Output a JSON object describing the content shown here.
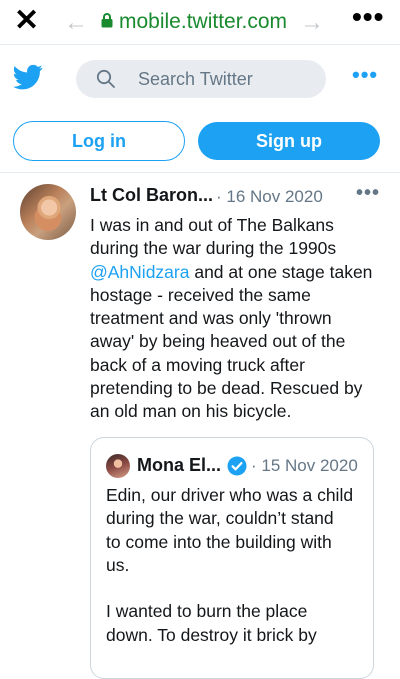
{
  "browser": {
    "close": "✕",
    "back": "←",
    "url": "mobile.twitter.com",
    "forward": "→",
    "more": "•••"
  },
  "header": {
    "logo_icon": "twitter-bird-icon",
    "search_placeholder": "Search Twitter",
    "more": "•••"
  },
  "auth": {
    "login_label": "Log in",
    "signup_label": "Sign up"
  },
  "colors": {
    "accent": "#1da1f2",
    "url_green": "#1a8a2f",
    "muted": "#657786"
  },
  "tweet": {
    "author_name": "Lt Col Baron...",
    "date": "· 16 Nov 2020",
    "more": "•••",
    "lines": [
      "I was in and out of The Balkans",
      "during the war during the 1990s",
      "",
      "hostage - received the same",
      "treatment and was only 'thrown",
      "away' by being heaved out of the",
      "back of a moving truck after",
      "pretending to be dead. Rescued by",
      "an old man on his bicycle."
    ],
    "mention": "@AhNidzara",
    "mention_rest": " and at one stage taken"
  },
  "quote": {
    "author_name": "Mona El...",
    "date": "· 15 Nov 2020",
    "lines": [
      "Edin, our driver who was a child",
      "during the war, couldn’t stand",
      "to come into the building with",
      "us.",
      "",
      "I wanted to burn the place",
      "down. To destroy it brick by"
    ]
  }
}
